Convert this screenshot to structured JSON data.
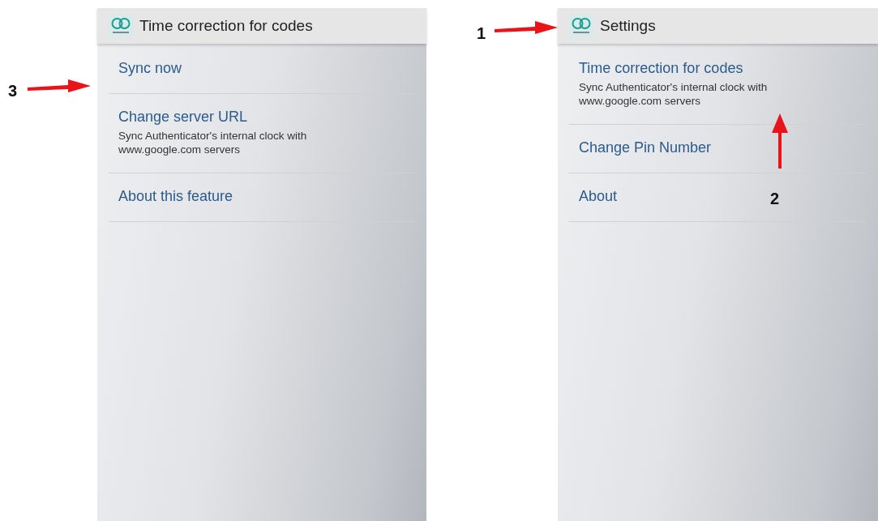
{
  "annotations": [
    {
      "label": "3",
      "kind": "right"
    },
    {
      "label": "1",
      "kind": "right"
    },
    {
      "label": "2",
      "kind": "up"
    }
  ],
  "screens": [
    {
      "title": "Time correction for codes",
      "items": [
        {
          "title": "Sync now"
        },
        {
          "title": "Change server URL",
          "summary": "Sync Authenticator's internal clock with www.google.com servers"
        },
        {
          "title": "About this feature"
        }
      ]
    },
    {
      "title": "Settings",
      "items": [
        {
          "title": "Time correction for codes",
          "summary": "Sync Authenticator's internal clock with www.google.com servers"
        },
        {
          "title": "Change Pin Number"
        },
        {
          "title": "About"
        }
      ]
    }
  ]
}
